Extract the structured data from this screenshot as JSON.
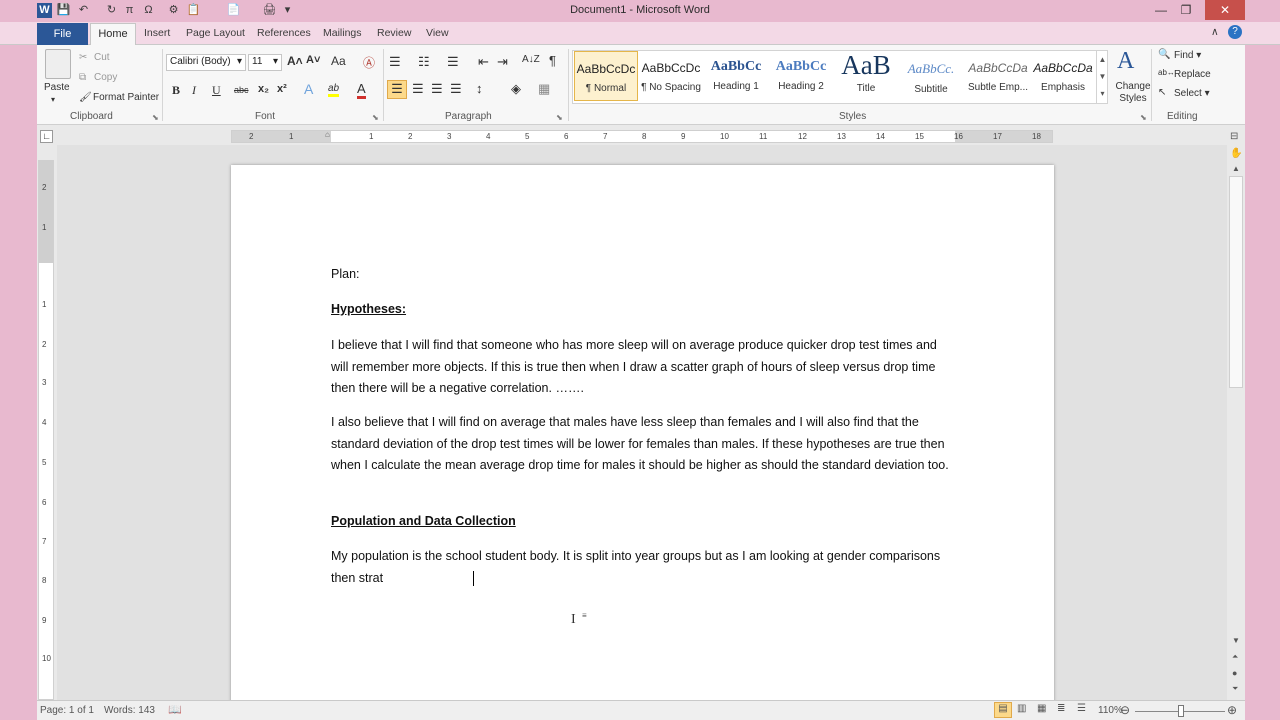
{
  "window": {
    "title": "Document1 - Microsoft Word",
    "minimize": "—",
    "restore": "❐",
    "close": "✕"
  },
  "quick_access": [
    "W",
    "💾",
    "↶",
    "↻",
    "π",
    "Ω",
    "⚙",
    "📋",
    "📄",
    "🖨",
    "▾"
  ],
  "tabs": {
    "file": "File",
    "items": [
      "Home",
      "Insert",
      "Page Layout",
      "References",
      "Mailings",
      "Review",
      "View"
    ]
  },
  "help_icons": {
    "collapse": "∧",
    "help": "?"
  },
  "clipboard": {
    "paste": "Paste",
    "cut": "Cut",
    "copy": "Copy",
    "format_painter": "Format Painter",
    "label": "Clipboard"
  },
  "font": {
    "name": "Calibri (Body)",
    "size": "11",
    "label": "Font",
    "bold": "B",
    "italic": "I",
    "underline": "U",
    "strike": "abc",
    "sub": "x₂",
    "sup": "x²",
    "grow": "A˄",
    "shrink": "A˅",
    "case": "Aa",
    "clear": "Ⓐ",
    "effects": "A",
    "highlight": "ab",
    "color": "A"
  },
  "paragraph": {
    "label": "Paragraph",
    "pilcrow": "¶",
    "sort": "A↓Z"
  },
  "styles": {
    "label": "Styles",
    "items": [
      {
        "sample": "AaBbCcDc",
        "name": "¶ Normal"
      },
      {
        "sample": "AaBbCcDc",
        "name": "¶ No Spacing"
      },
      {
        "sample": "AaBbCc",
        "name": "Heading 1"
      },
      {
        "sample": "AaBbCc",
        "name": "Heading 2"
      },
      {
        "sample": "AaB",
        "name": "Title"
      },
      {
        "sample": "AaBbCc.",
        "name": "Subtitle"
      },
      {
        "sample": "AaBbCcDa",
        "name": "Subtle Emp..."
      },
      {
        "sample": "AaBbCcDa",
        "name": "Emphasis"
      }
    ],
    "change_styles": "Change Styles"
  },
  "editing": {
    "find": "Find",
    "replace": "Replace",
    "select": "Select",
    "label": "Editing"
  },
  "ruler": {
    "numbers": [
      "2",
      "1",
      "1",
      "2",
      "3",
      "4",
      "5",
      "6",
      "7",
      "8",
      "9",
      "10",
      "11",
      "12",
      "13",
      "14",
      "15",
      "16",
      "17",
      "18"
    ]
  },
  "vruler": {
    "numbers": [
      "2",
      "1",
      "1",
      "2",
      "3",
      "4",
      "5",
      "6",
      "7",
      "8",
      "9",
      "10"
    ]
  },
  "document": {
    "plan": "Plan:",
    "heading1": "Hypotheses:",
    "para1": "I believe that I will find that someone who has more sleep will on average produce quicker drop test times and will remember more objects.  If this is true then when I draw a scatter graph of hours of sleep versus drop time then there will be a negative correlation.  …….",
    "para2": "I also believe that I will find on average that males have less sleep than females and I will also find that the standard deviation of the drop test times will be lower for females than males.  If these hypotheses are true then when I calculate the mean average drop time for males it should be higher as should the standard deviation too.",
    "heading2": "Population and Data Collection",
    "para3": "My population is the school student body.  It is split into year groups but as I am looking at gender comparisons then strat"
  },
  "status": {
    "page": "Page: 1 of 1",
    "words": "Words: 143",
    "zoom": "110%",
    "zoom_minus": "⊖",
    "zoom_plus": "⊕"
  }
}
